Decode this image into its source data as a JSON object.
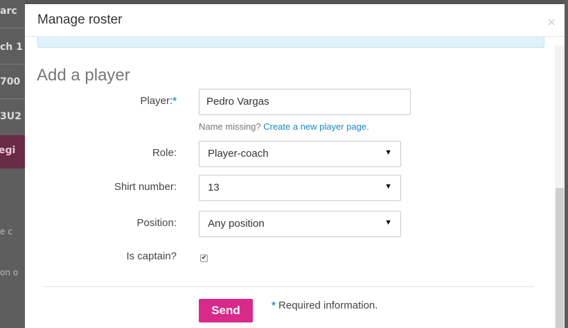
{
  "background": {
    "items": [
      "arc",
      "ch 1",
      "700",
      "3U2",
      "egi",
      "e c",
      "on o"
    ]
  },
  "modal": {
    "title": "Manage roster",
    "close_icon": "×",
    "section_title": "Add a player",
    "fields": {
      "player": {
        "label": "Player:",
        "required_mark": "*",
        "value": "Pedro Vargas"
      },
      "help": {
        "text": "Name missing?",
        "link": "Create a new player page."
      },
      "role": {
        "label": "Role:",
        "value": "Player-coach"
      },
      "shirt": {
        "label": "Shirt number:",
        "value": "13"
      },
      "position": {
        "label": "Position:",
        "value": "Any position"
      },
      "captain": {
        "label": "Is captain?",
        "checked": true
      }
    },
    "send_label": "Send",
    "required_note": {
      "star": "*",
      "text": "Required information."
    },
    "dropdown_arrow": "▼",
    "check_mark": "✔"
  },
  "colors": {
    "accent": "#d9298a",
    "link": "#1a87c9",
    "required": "#1a9fd8"
  }
}
